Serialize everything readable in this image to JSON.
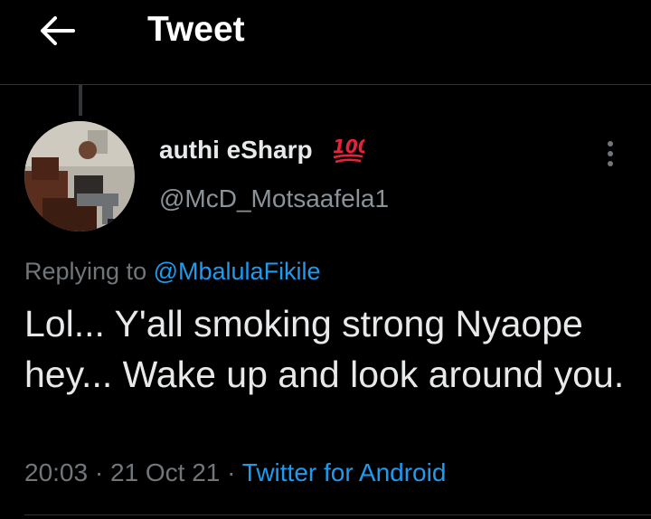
{
  "header": {
    "title": "Tweet",
    "back_icon": "arrow-left-icon"
  },
  "tweet": {
    "author": {
      "display_name": "authi eSharp",
      "emoji": "100-emoji",
      "handle": "@McD_Motsaafela1"
    },
    "replying_prefix": "Replying to",
    "replying_to": "@MbalulaFikile",
    "text": "Lol... Y'all smoking strong Nyaope hey... Wake up and look around you.",
    "time": "20:03",
    "date": "21 Oct 21",
    "separator": "·",
    "source": "Twitter for Android"
  },
  "colors": {
    "background": "#000000",
    "text": "#e7e9ea",
    "secondary": "#71767b",
    "accent": "#1d9bf0",
    "emoji_red": "#e3243b"
  }
}
